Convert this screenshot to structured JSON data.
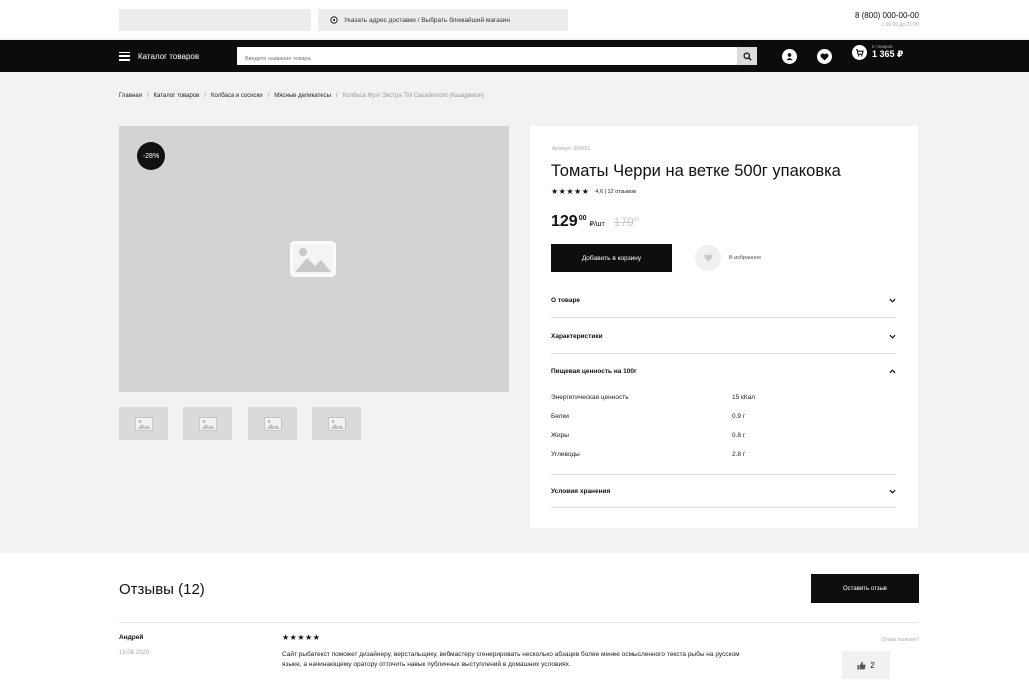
{
  "header": {
    "address_label": "Указать адрес доставки / Выбрать ближайший магазин",
    "phone": "8 (800) 000-00-00",
    "phone_hours": "с 09:00 до 21:00"
  },
  "nav": {
    "catalog_label": "Каталог товаров",
    "search_placeholder": "Введите название товара",
    "cart_count": "5 товаров",
    "cart_total": "1 365 ₽"
  },
  "breadcrumbs": [
    "Главная",
    "Каталог товаров",
    "Колбаса и сосиски",
    "Мясные деликатесы",
    "Колбаса Фуэт Экстра ТМ Casademont (Казадемон)"
  ],
  "gallery": {
    "discount_badge": "-28%",
    "thumbnail_count": 4
  },
  "product": {
    "sku": "Артикул: 304651",
    "title": "Томаты Черри на ветке 500г упаковка",
    "stars": "★★★★★",
    "rating_text": "4,6 | 12 отзывов",
    "price": "129",
    "price_kop": "00",
    "price_unit": "₽/шт",
    "old_price": "179",
    "old_price_kop": "00",
    "add_to_cart": "Добавить в корзину",
    "favorite": "В избранное",
    "accordions": {
      "about": "О товаре",
      "specs": "Характеристики",
      "nutrition": "Пищевая ценность на 100г",
      "storage": "Условия хранения"
    },
    "nutrition": [
      {
        "name": "Энергетическая ценность",
        "value": "15 кКал"
      },
      {
        "name": "Белки",
        "value": "0.9 г"
      },
      {
        "name": "Жиры",
        "value": "0.8 г"
      },
      {
        "name": "Углеводы",
        "value": "2.8 г"
      }
    ]
  },
  "reviews": {
    "title": "Отзывы (12)",
    "leave_review": "Оставить отзыв",
    "items": [
      {
        "author": "Андрей",
        "date": "15.06.2020",
        "stars": "★★★★★",
        "text": "Сайт рыбатекст поможет дизайнеру, верстальщику, вебмастеру сгенерировать несколько абзацев более менее осмысленного текста рыбы на русском языке, а начинающему оратору отточить навык публичных выступлений в домашних условиях.",
        "useful_label": "Отзыв полезен?",
        "likes": "2"
      }
    ]
  },
  "colors": {
    "dark": "#0e0e0e",
    "placeholder_gray": "#d3d3d3",
    "page_bg": "#f2f2f2"
  }
}
